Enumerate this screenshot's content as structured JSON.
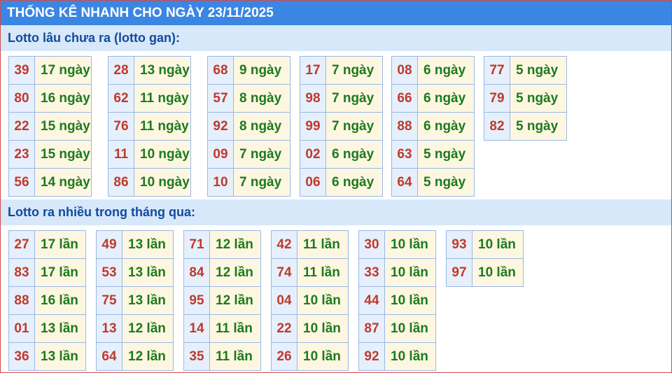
{
  "title": "THỐNG KÊ NHANH CHO NGÀY 23/11/2025",
  "section_gan": {
    "heading": "Lotto lâu chưa ra (lotto gan):",
    "groups": [
      [
        [
          "39",
          "17 ngày"
        ],
        [
          "80",
          "16 ngày"
        ],
        [
          "22",
          "15 ngày"
        ],
        [
          "23",
          "15 ngày"
        ],
        [
          "56",
          "14 ngày"
        ]
      ],
      [
        [
          "28",
          "13 ngày"
        ],
        [
          "62",
          "11 ngày"
        ],
        [
          "76",
          "11 ngày"
        ],
        [
          "11",
          "10 ngày"
        ],
        [
          "86",
          "10 ngày"
        ]
      ],
      [
        [
          "68",
          "9 ngày"
        ],
        [
          "57",
          "8 ngày"
        ],
        [
          "92",
          "8 ngày"
        ],
        [
          "09",
          "7 ngày"
        ],
        [
          "10",
          "7 ngày"
        ]
      ],
      [
        [
          "17",
          "7 ngày"
        ],
        [
          "98",
          "7 ngày"
        ],
        [
          "99",
          "7 ngày"
        ],
        [
          "02",
          "6 ngày"
        ],
        [
          "06",
          "6 ngày"
        ]
      ],
      [
        [
          "08",
          "6 ngày"
        ],
        [
          "66",
          "6 ngày"
        ],
        [
          "88",
          "6 ngày"
        ],
        [
          "63",
          "5 ngày"
        ],
        [
          "64",
          "5 ngày"
        ]
      ],
      [
        [
          "77",
          "5 ngày"
        ],
        [
          "79",
          "5 ngày"
        ],
        [
          "82",
          "5 ngày"
        ]
      ]
    ]
  },
  "section_freq": {
    "heading": "Lotto ra nhiều trong tháng qua:",
    "groups": [
      [
        [
          "27",
          "17 lần"
        ],
        [
          "83",
          "17 lần"
        ],
        [
          "88",
          "16 lần"
        ],
        [
          "01",
          "13 lần"
        ],
        [
          "36",
          "13 lần"
        ]
      ],
      [
        [
          "49",
          "13 lần"
        ],
        [
          "53",
          "13 lần"
        ],
        [
          "75",
          "13 lần"
        ],
        [
          "13",
          "12 lần"
        ],
        [
          "64",
          "12 lần"
        ]
      ],
      [
        [
          "71",
          "12 lần"
        ],
        [
          "84",
          "12 lần"
        ],
        [
          "95",
          "12 lần"
        ],
        [
          "14",
          "11 lần"
        ],
        [
          "35",
          "11 lần"
        ]
      ],
      [
        [
          "42",
          "11 lần"
        ],
        [
          "74",
          "11 lần"
        ],
        [
          "04",
          "10 lần"
        ],
        [
          "22",
          "10 lần"
        ],
        [
          "26",
          "10 lần"
        ]
      ],
      [
        [
          "30",
          "10 lần"
        ],
        [
          "33",
          "10 lần"
        ],
        [
          "44",
          "10 lần"
        ],
        [
          "87",
          "10 lần"
        ],
        [
          "92",
          "10 lần"
        ]
      ],
      [
        [
          "93",
          "10 lần"
        ],
        [
          "97",
          "10 lần"
        ]
      ]
    ]
  }
}
